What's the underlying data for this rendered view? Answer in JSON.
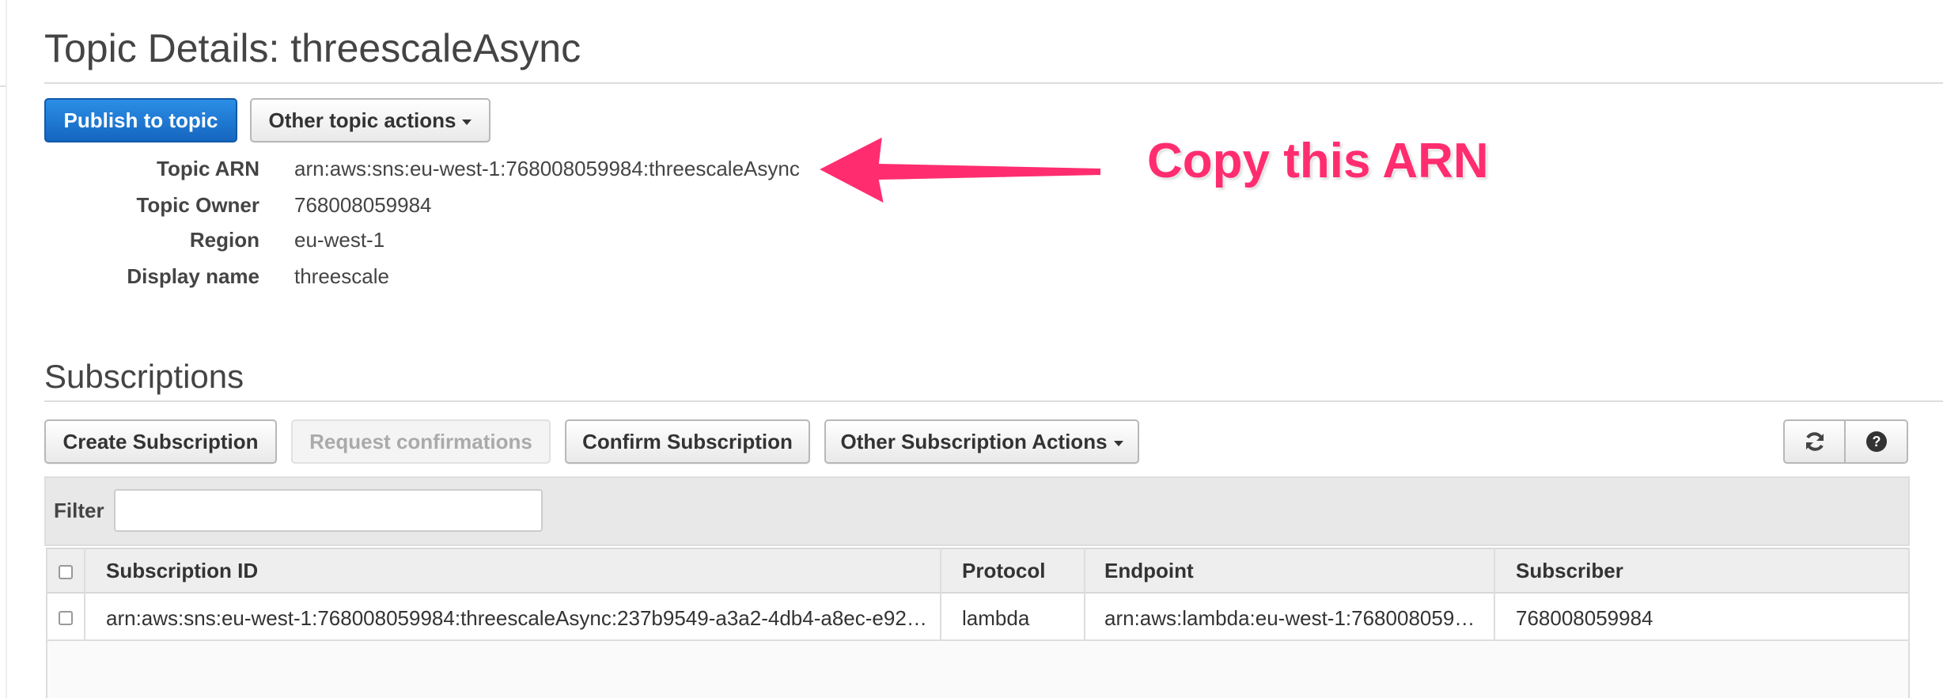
{
  "page": {
    "title": "Topic Details: threescaleAsync"
  },
  "topic_actions": {
    "publish_label": "Publish to topic",
    "other_actions_label": "Other topic actions"
  },
  "details": [
    {
      "label": "Topic ARN",
      "value": "arn:aws:sns:eu-west-1:768008059984:threescaleAsync"
    },
    {
      "label": "Topic Owner",
      "value": "768008059984"
    },
    {
      "label": "Region",
      "value": "eu-west-1"
    },
    {
      "label": "Display name",
      "value": "threescale"
    }
  ],
  "annotation": {
    "text": "Copy this ARN",
    "color": "#ff2d6f"
  },
  "subscriptions": {
    "title": "Subscriptions",
    "buttons": {
      "create": "Create Subscription",
      "request_confirmations": "Request confirmations",
      "confirm": "Confirm Subscription",
      "other_actions": "Other Subscription Actions"
    },
    "icons": [
      "refresh-icon",
      "help-icon"
    ],
    "filter": {
      "label": "Filter",
      "value": ""
    },
    "table": {
      "columns": [
        "Subscription ID",
        "Protocol",
        "Endpoint",
        "Subscriber"
      ],
      "rows": [
        {
          "subscription_id": "arn:aws:sns:eu-west-1:768008059984:threescaleAsync:237b9549-a3a2-4db4-a8ec-e9214...",
          "protocol": "lambda",
          "endpoint": "arn:aws:lambda:eu-west-1:76800805998...",
          "subscriber": "768008059984"
        }
      ]
    }
  },
  "colors": {
    "primary_button": "#1a73d1",
    "annotation": "#ff2d6f"
  }
}
